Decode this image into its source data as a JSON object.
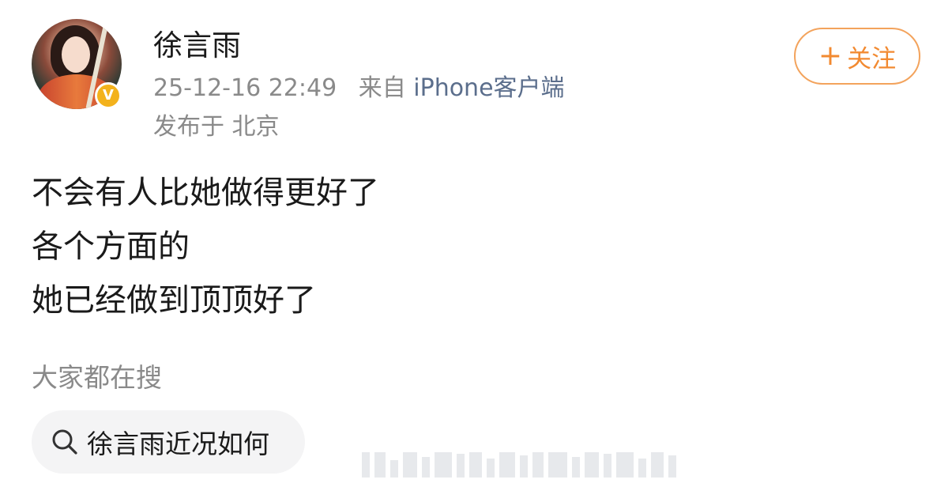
{
  "header": {
    "username": "徐言雨",
    "time": "25-12-16 22:49",
    "source_prefix": "来自",
    "source_client": "iPhone客户端",
    "location": "发布于 北京",
    "verified_badge": "V"
  },
  "follow": {
    "plus": "+",
    "label": "关注"
  },
  "post": {
    "lines": [
      "不会有人比她做得更好了",
      "各个方面的",
      "她已经做到顶顶好了"
    ]
  },
  "trending": {
    "label": "大家都在搜",
    "search_term": "徐言雨近况如何"
  },
  "colors": {
    "accent": "#f28a31",
    "link": "#5b6e8c",
    "muted": "#8a8a8a",
    "badge": "#f3b21c"
  }
}
